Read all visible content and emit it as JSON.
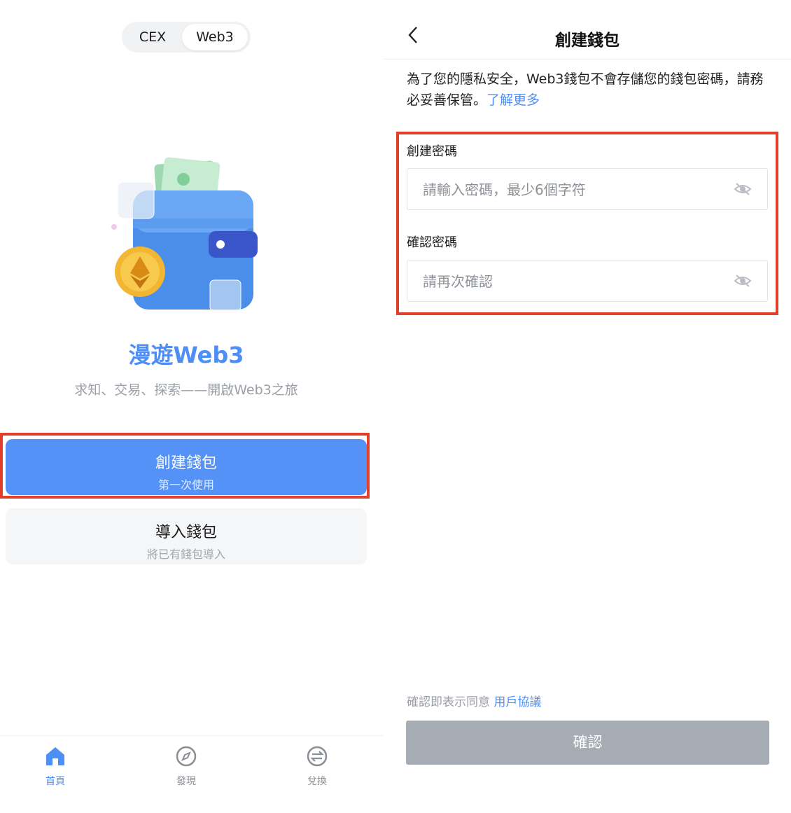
{
  "left": {
    "switch": {
      "cex_label": "CEX",
      "web3_label": "Web3",
      "selected": "Web3"
    },
    "hero": {
      "title": "漫遊Web3",
      "subtitle": "求知、交易、探索——開啟Web3之旅"
    },
    "create_button": {
      "title": "創建錢包",
      "subtitle": "第一次使用"
    },
    "import_button": {
      "title": "導入錢包",
      "subtitle": "將已有錢包導入"
    },
    "bottom_nav": [
      {
        "label": "首頁",
        "icon": "home-icon",
        "active": true
      },
      {
        "label": "發現",
        "icon": "compass-icon",
        "active": false
      },
      {
        "label": "兌換",
        "icon": "swap-icon",
        "active": false
      }
    ]
  },
  "right": {
    "header": {
      "title": "創建錢包",
      "back_icon": "chevron-left-icon"
    },
    "notice": {
      "text": "為了您的隱私安全，Web3錢包不會存儲您的錢包密碼，請務必妥善保管。",
      "link": "了解更多"
    },
    "password": {
      "label": "創建密碼",
      "placeholder": "請輸入密碼，最少6個字符",
      "icon": "eye-off-icon"
    },
    "confirm_password": {
      "label": "確認密碼",
      "placeholder": "請再次確認",
      "icon": "eye-off-icon"
    },
    "agreement": {
      "text": "確認即表示同意 ",
      "link": "用戶協議"
    },
    "confirm_button": {
      "label": "確認"
    }
  },
  "colors": {
    "accent": "#4e8ef7",
    "primary_button": "#5592f7",
    "disabled_button": "#a6acb4",
    "highlight": "#e2402b"
  }
}
